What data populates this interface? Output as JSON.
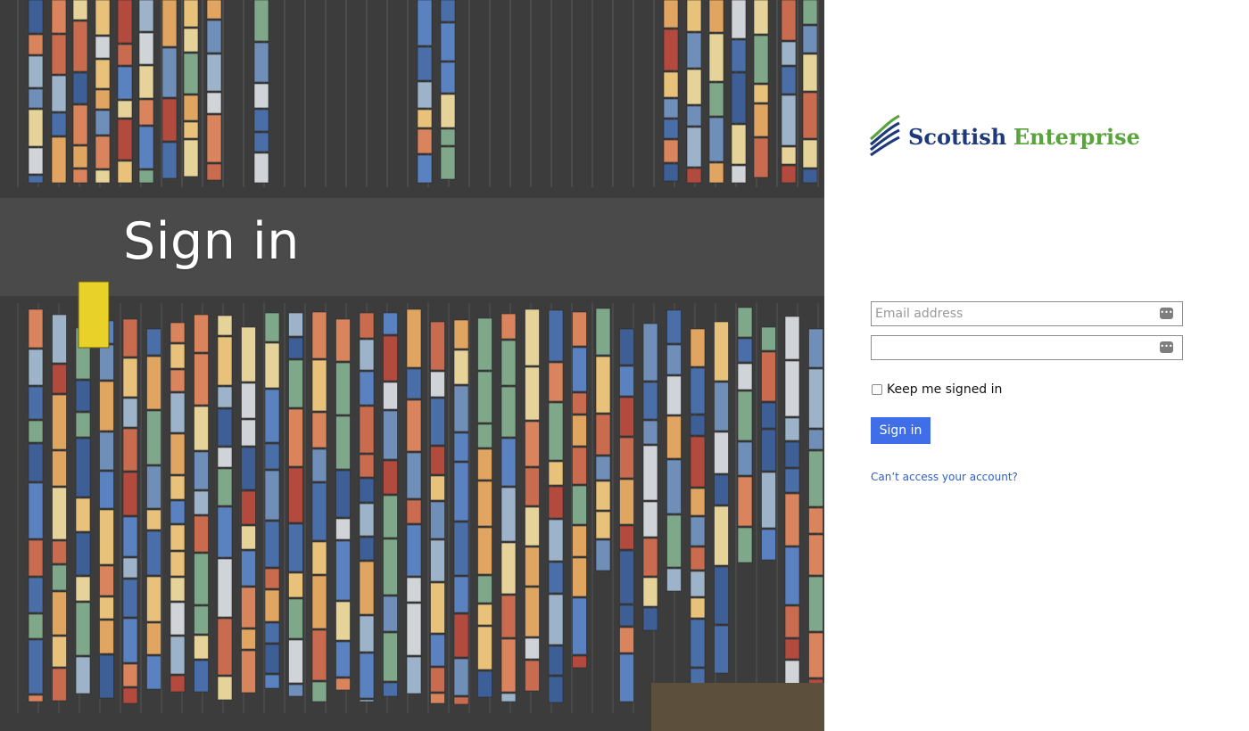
{
  "hero": {
    "title": "Sign in"
  },
  "brand": {
    "word1": "Scottish",
    "word2": "Enterprise",
    "colors": {
      "primary": "#1e3a7b",
      "secondary": "#5aa43d"
    }
  },
  "form": {
    "email_placeholder": "Email address",
    "password_placeholder": "",
    "key_badge_icon": "keyboard-dots-icon",
    "keep_signed_in_label": "Keep me signed in",
    "keep_signed_in_checked": false,
    "submit_label": "Sign in",
    "help_link": "Can’t access your account?"
  },
  "colors": {
    "button": "#3f6ee8",
    "link": "#2f5fc7",
    "field_border": "#8c8c8c"
  }
}
